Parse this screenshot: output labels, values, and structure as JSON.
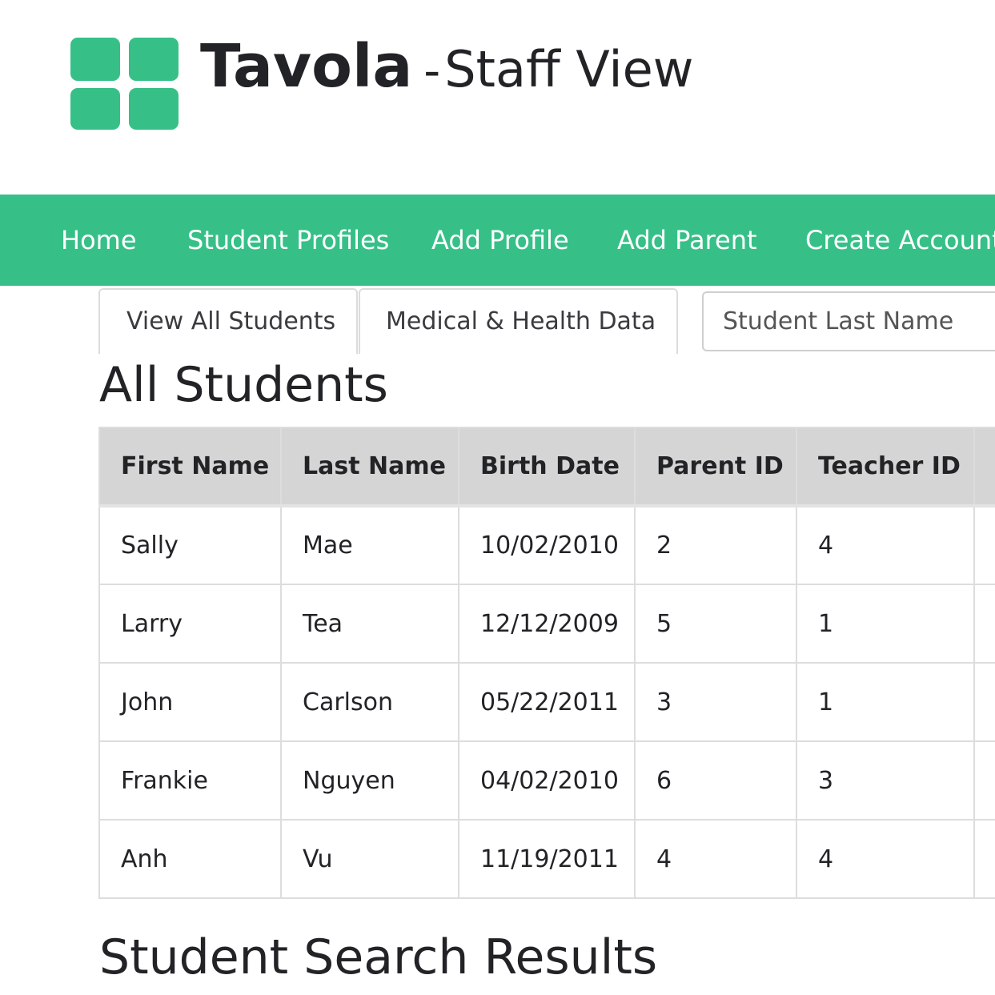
{
  "header": {
    "app_name": "Tavola",
    "separator": "-",
    "view_name": "Staff View",
    "logo": "grid-logo-icon",
    "accent_color": "#36c088"
  },
  "nav": {
    "items": [
      {
        "label": "Home"
      },
      {
        "label": "Student Profiles"
      },
      {
        "label": "Add Profile"
      },
      {
        "label": "Add Parent"
      },
      {
        "label": "Create Account"
      }
    ]
  },
  "tabs": [
    {
      "label": "View All Students"
    },
    {
      "label": "Medical & Health Data"
    }
  ],
  "search": {
    "placeholder": "Student Last Name",
    "value": ""
  },
  "all_students": {
    "title": "All Students",
    "columns": [
      "First Name",
      "Last Name",
      "Birth Date",
      "Parent ID",
      "Teacher ID"
    ],
    "rows": [
      {
        "first": "Sally",
        "last": "Mae",
        "birth": "10/02/2010",
        "parent": "2",
        "teacher": "4"
      },
      {
        "first": "Larry",
        "last": "Tea",
        "birth": "12/12/2009",
        "parent": "5",
        "teacher": "1"
      },
      {
        "first": "John",
        "last": "Carlson",
        "birth": "05/22/2011",
        "parent": "3",
        "teacher": "1"
      },
      {
        "first": "Frankie",
        "last": "Nguyen",
        "birth": "04/02/2010",
        "parent": "6",
        "teacher": "3"
      },
      {
        "first": "Anh",
        "last": "Vu",
        "birth": "11/19/2011",
        "parent": "4",
        "teacher": "4"
      }
    ]
  },
  "search_results": {
    "title": "Student Search Results"
  }
}
